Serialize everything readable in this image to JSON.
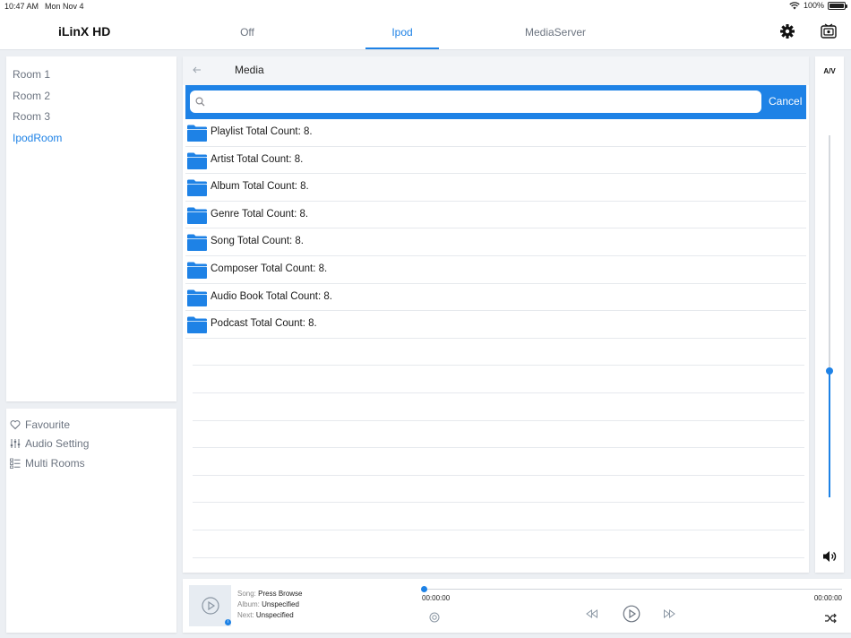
{
  "status_bar": {
    "time": "10:47 AM",
    "date": "Mon Nov 4",
    "battery": "100%"
  },
  "header": {
    "app_title": "iLinX HD",
    "tabs": [
      {
        "label": "Off",
        "active": false
      },
      {
        "label": "Ipod",
        "active": true
      },
      {
        "label": "MediaServer",
        "active": false
      }
    ],
    "icons": [
      "gear-icon",
      "av-device-icon"
    ]
  },
  "rooms": [
    {
      "label": "Room 1",
      "active": false
    },
    {
      "label": "Room 2",
      "active": false
    },
    {
      "label": "Room 3",
      "active": false
    },
    {
      "label": "IpodRoom",
      "active": true
    }
  ],
  "menu": [
    {
      "label": "Favourite",
      "icon": "heart-icon"
    },
    {
      "label": "Audio Setting",
      "icon": "sliders-icon"
    },
    {
      "label": "Multi Rooms",
      "icon": "list-icon"
    }
  ],
  "media": {
    "title": "Media",
    "search": {
      "value": "",
      "placeholder": ""
    },
    "cancel_label": "Cancel",
    "items": [
      "Playlist Total Count: 8.",
      "Artist Total Count: 8.",
      "Album Total Count: 8.",
      "Genre Total Count: 8.",
      "Song Total Count: 8.",
      "Composer Total Count: 8.",
      "Audio Book Total Count: 8.",
      "Podcast Total Count: 8."
    ]
  },
  "volume": {
    "label": "A/V",
    "level": 0.35
  },
  "player": {
    "song_label": "Song:",
    "song": "Press Browse",
    "album_label": "Album:",
    "album": "Unspecified",
    "next_label": "Next:",
    "next": "Unspecified",
    "elapsed": "00:00:00",
    "duration": "00:00:00",
    "progress": 0
  },
  "colors": {
    "accent": "#1e82e6",
    "background": "#eceff3",
    "text_muted": "#6c7480"
  }
}
